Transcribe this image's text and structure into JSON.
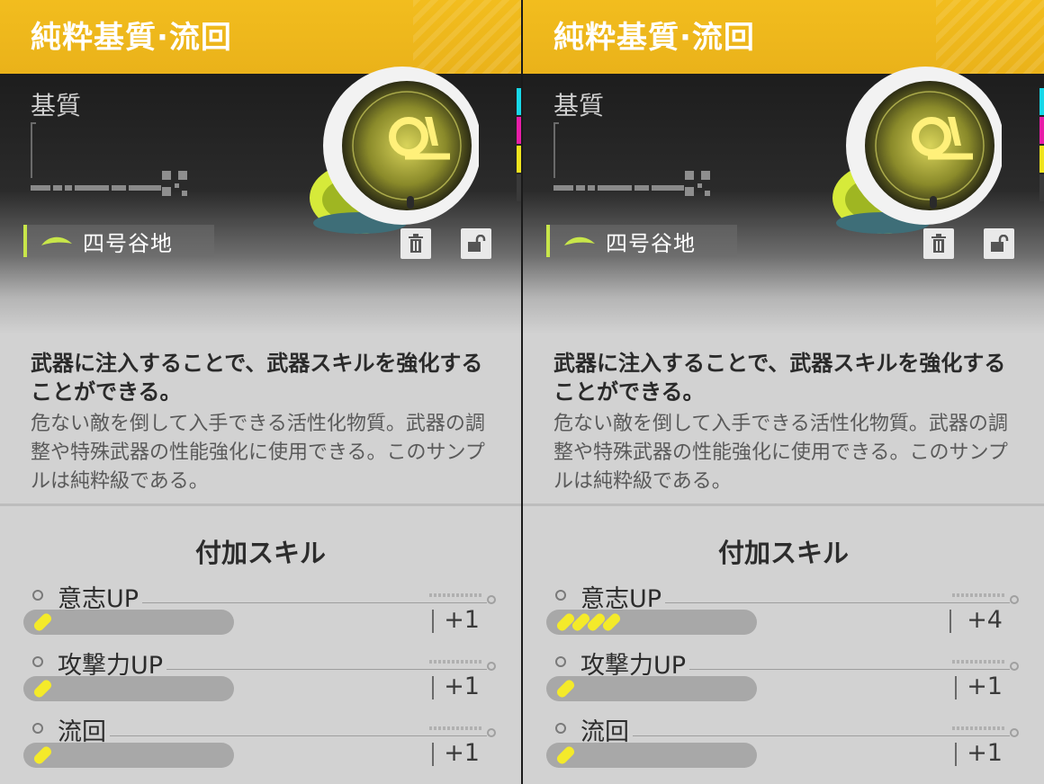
{
  "panels": [
    {
      "title": "純粋基質·流回",
      "section_label": "基質",
      "region": "四号谷地",
      "description_main": "武器に注入することで、武器スキルを強化することができる。",
      "description_sub": "危ない敵を倒して入手できる活性化物質。武器の調整や特殊武器の性能強化に使用できる。このサンプルは純粋級である。",
      "skills_title": "付加スキル",
      "skills": [
        {
          "name": "意志UP",
          "level": 1,
          "value": "+1"
        },
        {
          "name": "攻撃力UP",
          "level": 1,
          "value": "+1"
        },
        {
          "name": "流回",
          "level": 1,
          "value": "+1"
        }
      ],
      "icons": {
        "trash": "trash-icon",
        "lock": "unlock-icon",
        "region": "leaf-icon"
      }
    },
    {
      "title": "純粋基質·流回",
      "section_label": "基質",
      "region": "四号谷地",
      "description_main": "武器に注入することで、武器スキルを強化することができる。",
      "description_sub": "危ない敵を倒して入手できる活性化物質。武器の調整や特殊武器の性能強化に使用できる。このサンプルは純粋級である。",
      "skills_title": "付加スキル",
      "skills": [
        {
          "name": "意志UP",
          "level": 4,
          "value": "+4"
        },
        {
          "name": "攻撃力UP",
          "level": 1,
          "value": "+1"
        },
        {
          "name": "流回",
          "level": 1,
          "value": "+1"
        }
      ],
      "icons": {
        "trash": "trash-icon",
        "lock": "unlock-icon",
        "region": "leaf-icon"
      }
    }
  ],
  "colors": {
    "header": "#f2bd1e",
    "accent": "#c8e64a",
    "skill_fill": "#f4ea2a",
    "cmyk": [
      "#18d8e8",
      "#e81ea8",
      "#f0e41e",
      "#3a3a3a"
    ]
  }
}
